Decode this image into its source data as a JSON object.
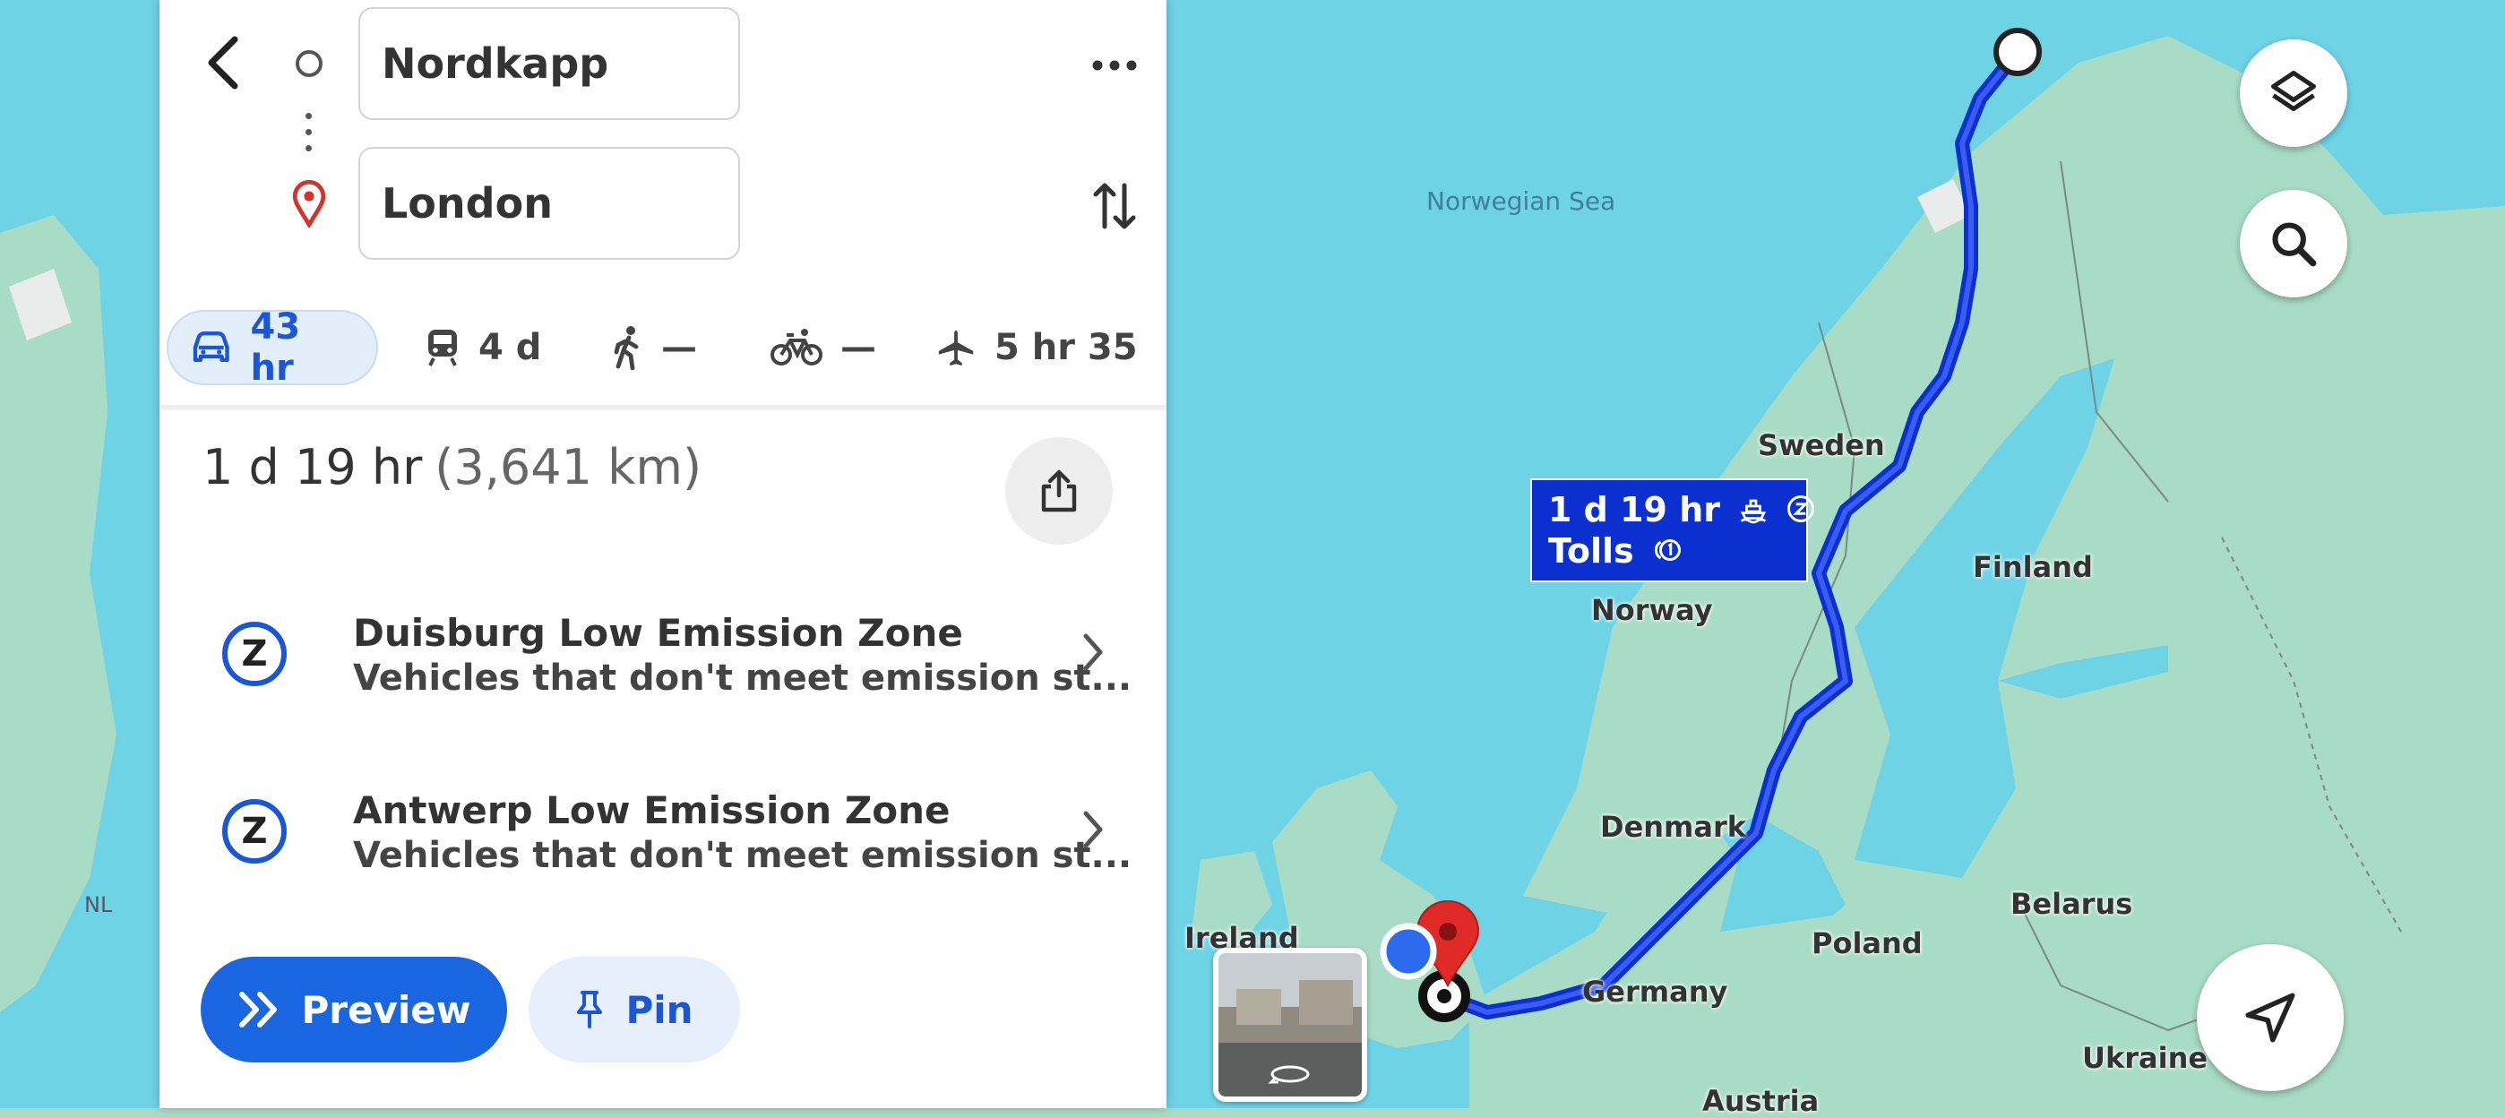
{
  "directions": {
    "origin": "Nordkapp",
    "destination": "London"
  },
  "modes": [
    {
      "name": "drive",
      "label": "43 hr",
      "active": true
    },
    {
      "name": "transit",
      "label": "4 d"
    },
    {
      "name": "walk",
      "label": "—"
    },
    {
      "name": "bike",
      "label": "—"
    },
    {
      "name": "flight",
      "label": "5 hr 35"
    }
  ],
  "summary": {
    "duration": "1 d 19 hr",
    "distance": "(3,641 km)"
  },
  "zones": [
    {
      "icon": "Z",
      "title": "Duisburg Low Emission Zone",
      "desc": "Vehicles that don't meet emission st..."
    },
    {
      "icon": "Z",
      "title": "Antwerp Low Emission Zone",
      "desc": "Vehicles that don't meet emission st..."
    }
  ],
  "actions": {
    "preview": "Preview",
    "pin": "Pin"
  },
  "map": {
    "callout": {
      "line1": "1 d 19 hr",
      "line2": "Tolls"
    },
    "labels": {
      "sea": "Norwegian Sea",
      "sweden": "Sweden",
      "finland": "Finland",
      "norway": "Norway",
      "denmark": "Denmark",
      "ireland": "Ireland",
      "poland": "Poland",
      "belarus": "Belarus",
      "germany": "Germany",
      "ukraine": "Ukraine",
      "austria": "Austria",
      "nl": "NL"
    }
  },
  "colors": {
    "water": "#6fd3e6",
    "land": "#a9dcc6",
    "route": "#0c2fd0",
    "accent": "#1a66e0",
    "destination_pin": "#e02a27"
  }
}
